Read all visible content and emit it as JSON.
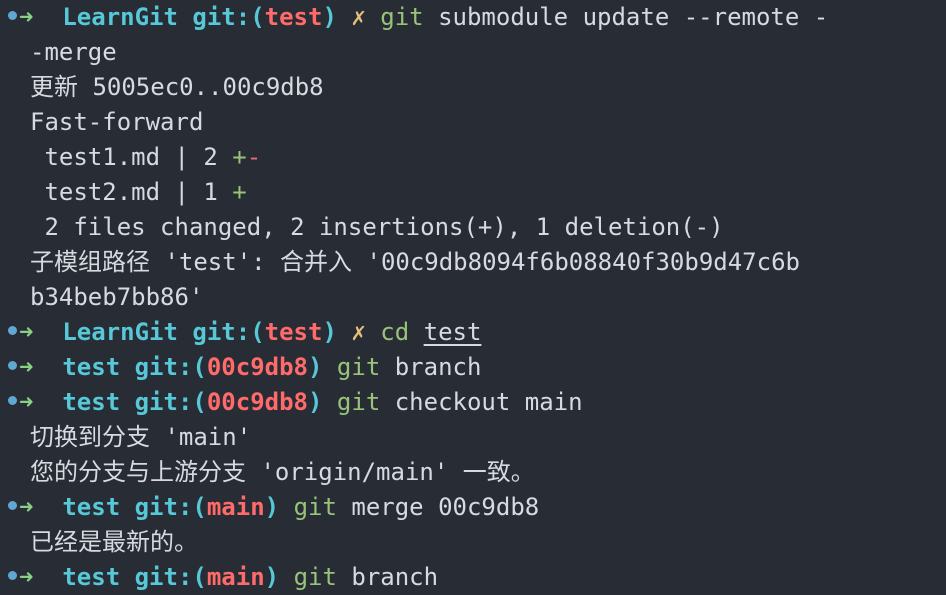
{
  "terminal": {
    "lines": [
      {
        "type": "prompt",
        "dir": "LearnGit",
        "git": "git:",
        "branch": "test",
        "dirty": "✗",
        "cmd": "git",
        "args": "submodule update --remote -"
      },
      {
        "type": "output",
        "text": "-merge"
      },
      {
        "type": "output",
        "text": "更新 5005ec0..00c9db8"
      },
      {
        "type": "output",
        "text": "Fast-forward"
      },
      {
        "type": "diffstat",
        "file": " test1.md | 2 ",
        "plus": "+",
        "minus": "-"
      },
      {
        "type": "diffstat",
        "file": " test2.md | 1 ",
        "plus": "+",
        "minus": ""
      },
      {
        "type": "output",
        "text": " 2 files changed, 2 insertions(+), 1 deletion(-)"
      },
      {
        "type": "output",
        "text": "子模组路径 'test': 合并入 '00c9db8094f6b08840f30b9d47c6b"
      },
      {
        "type": "output",
        "text": "b34beb7bb86'"
      },
      {
        "type": "prompt",
        "dir": "LearnGit",
        "git": "git:",
        "branch": "test",
        "dirty": "✗",
        "cmd": "cd",
        "args": "test",
        "underline_args": true
      },
      {
        "type": "prompt",
        "dir": "test",
        "git": "git:",
        "branch": "00c9db8",
        "dirty": "",
        "cmd": "git",
        "args": "branch"
      },
      {
        "type": "prompt",
        "dir": "test",
        "git": "git:",
        "branch": "00c9db8",
        "dirty": "",
        "cmd": "git",
        "args": "checkout main"
      },
      {
        "type": "output",
        "text": "切换到分支 'main'"
      },
      {
        "type": "output",
        "text": "您的分支与上游分支 'origin/main' 一致。"
      },
      {
        "type": "prompt",
        "dir": "test",
        "git": "git:",
        "branch": "main",
        "dirty": "",
        "cmd": "git",
        "args": "merge 00c9db8"
      },
      {
        "type": "output",
        "text": "已经是最新的。"
      },
      {
        "type": "prompt",
        "dir": "test",
        "git": "git:",
        "branch": "main",
        "dirty": "",
        "cmd": "git",
        "args": "branch"
      }
    ]
  },
  "prompt_symbol": "➜",
  "colors": {
    "background": "#282c34",
    "arrow": "#89d185",
    "dir": "#56c8d8",
    "branch": "#ff6b6b",
    "dirty": "#e5c07b",
    "command": "#98c379",
    "text": "#d7dae0",
    "dot": "#5fa8d3"
  },
  "icons": {
    "prompt_dot": "status-dot-icon",
    "prompt_arrow": "arrow-right-icon"
  }
}
